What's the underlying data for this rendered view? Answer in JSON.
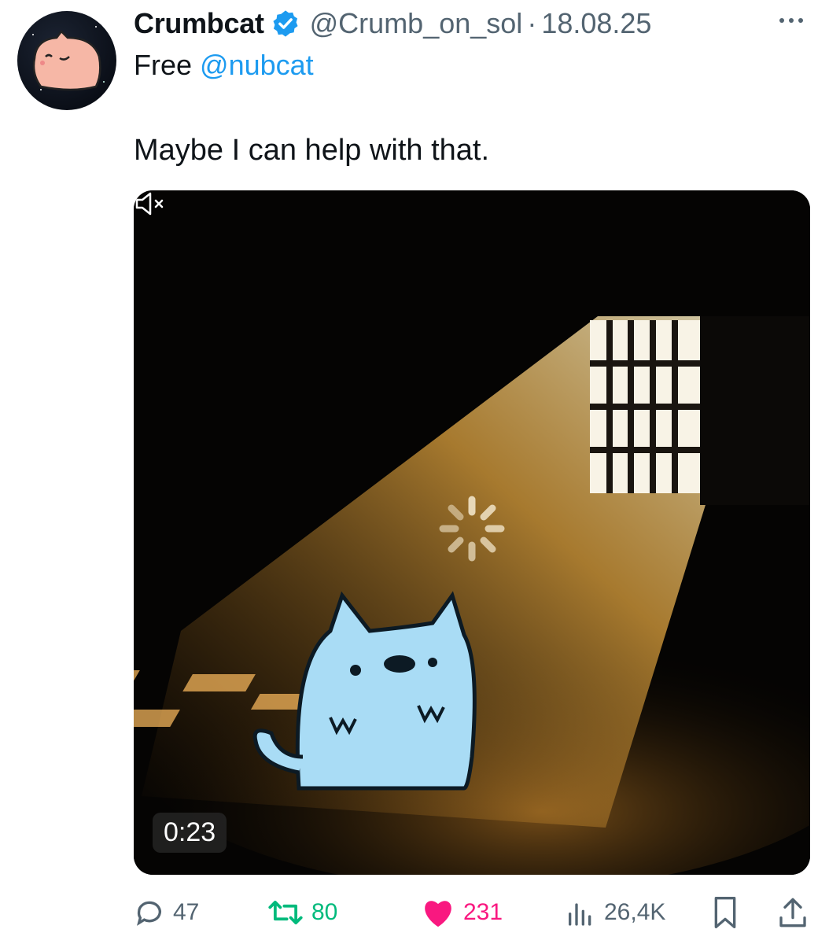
{
  "author": {
    "name": "Crumbcat",
    "handle": "@Crumb_on_sol",
    "separator": "·",
    "date": "18.08.25",
    "verified": true
  },
  "reply_to": {
    "prefix": "Free",
    "mention": "@nubcat"
  },
  "tweet": {
    "text": "Maybe I can help with that."
  },
  "media": {
    "duration": "0:23",
    "muted": true,
    "loading": true
  },
  "actions": {
    "replies": "47",
    "reposts": "80",
    "likes": "231",
    "views": "26,4K",
    "liked": true
  },
  "colors": {
    "accent": "#1d9bf0",
    "repost": "#00ba7c",
    "like": "#f91880",
    "muted_text": "#536471"
  },
  "icons": [
    "verified-badge-icon",
    "more-icon",
    "loading-spinner-icon",
    "mute-icon",
    "reply-icon",
    "repost-icon",
    "like-icon",
    "views-icon",
    "bookmark-icon",
    "share-icon"
  ]
}
